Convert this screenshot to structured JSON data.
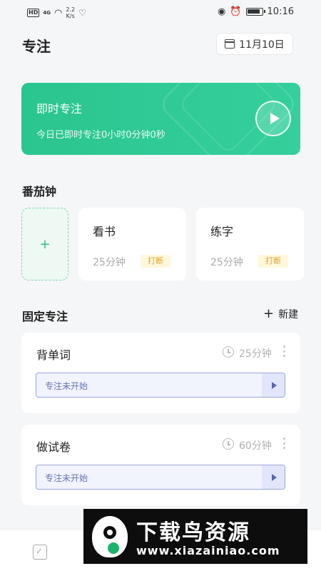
{
  "status_bar": {
    "hd": "HD",
    "signal": "4G",
    "speed_value": "2.2",
    "speed_unit": "K/s",
    "time": "10:16"
  },
  "header": {
    "title": "专注",
    "date": "11月10日"
  },
  "banner": {
    "title": "即时专注",
    "subtitle": "今日已即时专注0小时0分钟0秒",
    "colors": {
      "start": "#2bc58f",
      "end": "#34cf9c"
    }
  },
  "tomato": {
    "section_title": "番茄钟",
    "add_label": "+",
    "cards": [
      {
        "title": "看书",
        "duration": "25分钟",
        "badge": "打断"
      },
      {
        "title": "练字",
        "duration": "25分钟",
        "badge": "打断"
      }
    ]
  },
  "fixed": {
    "section_title": "固定专注",
    "new_label": "新建",
    "items": [
      {
        "title": "背单词",
        "duration": "25分钟",
        "status": "专注未开始"
      },
      {
        "title": "做试卷",
        "duration": "60分钟",
        "status": "专注未开始"
      }
    ]
  },
  "watermark": {
    "title": "下载鸟资源",
    "url": "www.xiazainiao.com"
  },
  "icons": [
    "wifi-icon",
    "heart-icon",
    "eye-icon",
    "alarm-icon",
    "battery-icon",
    "calendar-icon",
    "play-icon",
    "clock-icon",
    "more-icon",
    "plus-icon",
    "checklist-icon"
  ]
}
